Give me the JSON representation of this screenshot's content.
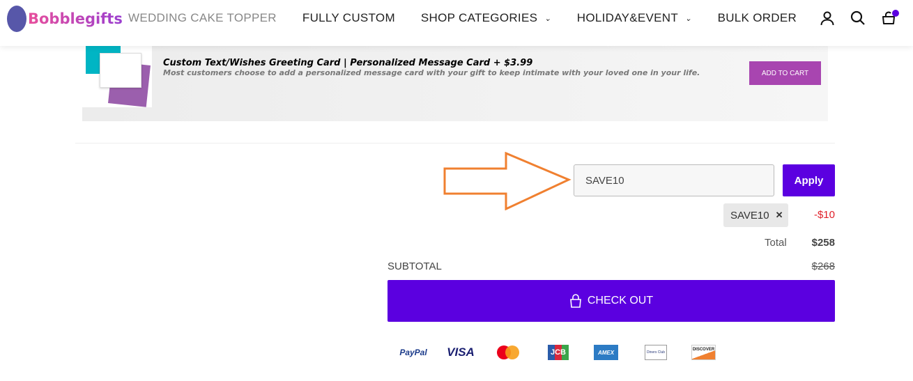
{
  "header": {
    "logo_text": "Bobblegifts",
    "nav": [
      {
        "label": "WEDDING CAKE TOPPER"
      },
      {
        "label": "FULLY CUSTOM"
      },
      {
        "label": "SHOP CATEGORIES"
      },
      {
        "label": "HOLIDAY&EVENT"
      },
      {
        "label": "BULK ORDER"
      }
    ],
    "icons": [
      "user-icon",
      "search-icon",
      "cart-icon"
    ],
    "cart_badge_color": "#5b00e0"
  },
  "addon": {
    "title": "Custom Text/Wishes Greeting Card | Personalized Message Card + $3.99",
    "description": "Most customers choose to add a personalized message card with your gift to keep intimate with your loved one in your life.",
    "button": "ADD TO CART",
    "button_color": "#a845b0"
  },
  "coupon": {
    "value": "SAVE10",
    "apply": "Apply",
    "applied_code": "SAVE10",
    "discount": "-$10"
  },
  "totals": {
    "total_label": "Total",
    "total_value": "$258",
    "subtotal_label": "SUBTOTAL",
    "subtotal_value": "$268"
  },
  "checkout": {
    "label": "CHECK OUT",
    "color": "#5b00e0"
  },
  "payments": {
    "paypal": "PayPal",
    "visa": "VISA",
    "jcb": "JCB",
    "amex": "AMEX",
    "diners": "Diners Club",
    "discover": "DISCOVER"
  }
}
